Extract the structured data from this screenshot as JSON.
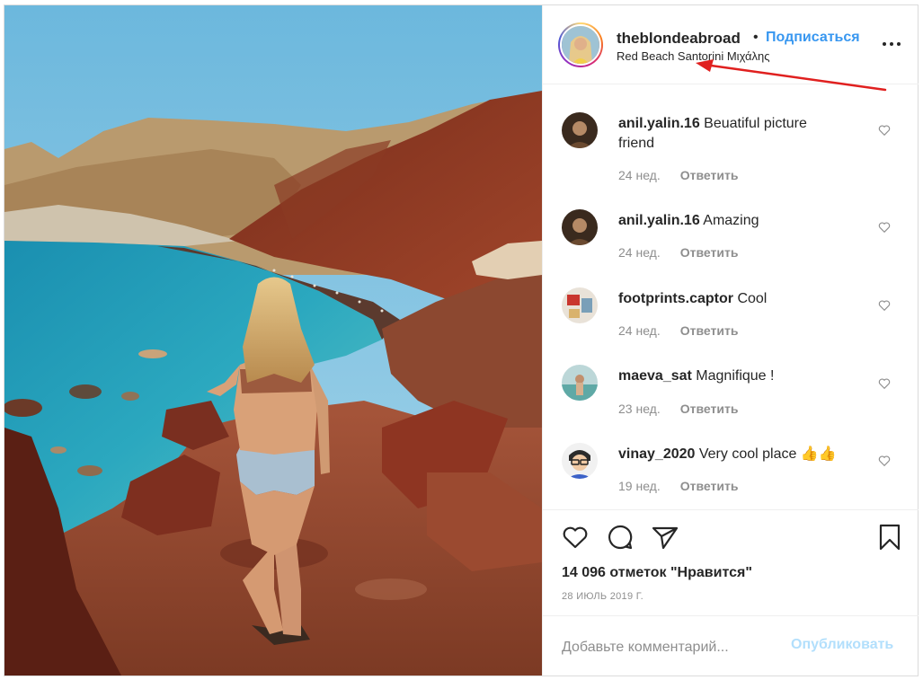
{
  "post": {
    "username": "theblondeabroad",
    "dot": "•",
    "follow_label": "Подписаться",
    "location": "Red Beach Santorini Μιχάλης",
    "icons": {
      "more": "more-options-icon",
      "like": "heart-icon",
      "comment": "comment-bubble-icon",
      "share": "paper-plane-icon",
      "save": "bookmark-icon",
      "comment_like": "small-heart-icon"
    }
  },
  "comments": [
    {
      "username": "anil.yalin.16",
      "text": "Beuatiful picture friend",
      "age": "24 нед.",
      "reply": "Ответить"
    },
    {
      "username": "anil.yalin.16",
      "text": "Amazing",
      "age": "24 нед.",
      "reply": "Ответить"
    },
    {
      "username": "footprints.captor",
      "text": "Cool",
      "age": "24 нед.",
      "reply": "Ответить"
    },
    {
      "username": "maeva_sat",
      "text": "Magnifique !",
      "age": "23 нед.",
      "reply": "Ответить"
    },
    {
      "username": "vinay_2020",
      "text": "Very cool place 👍👍",
      "age": "19 нед.",
      "reply": "Ответить"
    }
  ],
  "stats": {
    "likes": "14 096 отметок \"Нравится\"",
    "date": "28 ИЮЛЬ 2019 Г."
  },
  "composer": {
    "placeholder": "Добавьте комментарий...",
    "publish_label": "Опубликовать"
  },
  "colors": {
    "accent": "#3897f0",
    "publish_disabled": "#b2dffc",
    "annotation": "#e0201f"
  }
}
